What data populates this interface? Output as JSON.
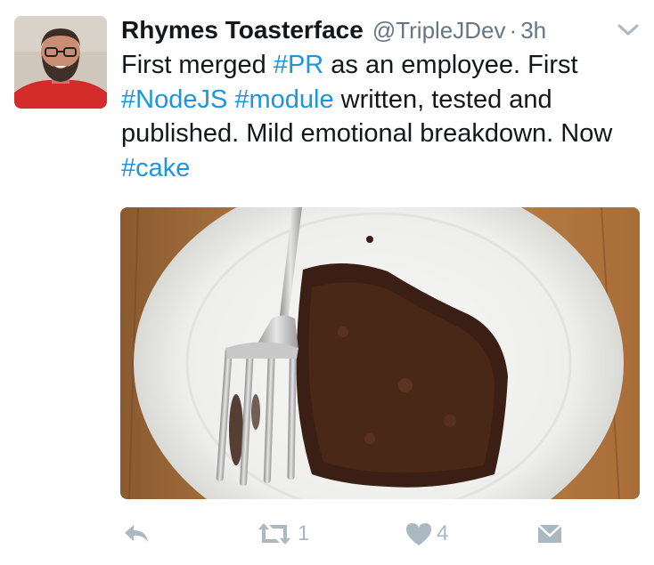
{
  "tweet": {
    "display_name": "Rhymes Toasterface",
    "handle": "@TripleJDev",
    "separator": "·",
    "time": "3h",
    "text_parts": {
      "p1": "First merged ",
      "h1": "#PR",
      "p2": " as an employee. First ",
      "h2": "#NodeJS",
      "p3": " ",
      "h3": "#module",
      "p4": " written, tested and published. Mild emotional breakdown. Now ",
      "h4": "#cake"
    },
    "media_icon": "photo-of-chocolate-cake-with-fork"
  },
  "actions": {
    "reply_icon": "reply-icon",
    "retweet_icon": "retweet-icon",
    "retweet_count": "1",
    "like_icon": "heart-icon",
    "like_count": "4",
    "dm_icon": "envelope-icon"
  },
  "colors": {
    "text": "#14171a",
    "secondary": "#657786",
    "hashtag": "#1b95e0",
    "action_icons": "#aab8c2"
  }
}
